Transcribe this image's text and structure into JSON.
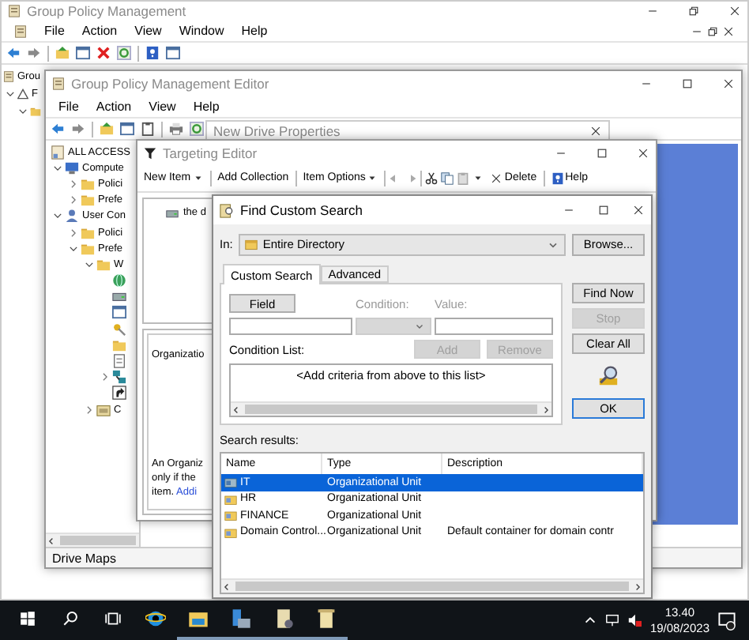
{
  "gpm": {
    "title": "Group Policy Management",
    "menu": [
      "File",
      "Action",
      "View",
      "Window",
      "Help"
    ],
    "tree": [
      {
        "label": "Grou",
        "kind": "console-root",
        "children": [
          {
            "label": "F",
            "kind": "domain",
            "expanded": true,
            "children": [
              {
                "kind": "folder",
                "expanded": true
              }
            ]
          }
        ]
      }
    ]
  },
  "gpme": {
    "title": "Group Policy Management Editor",
    "menu": [
      "File",
      "Action",
      "View",
      "Help"
    ],
    "tree": [
      {
        "label": "ALL ACCESS",
        "kind": "policy",
        "children": [
          {
            "label": "Compute",
            "kind": "computer",
            "expanded": true,
            "children": [
              {
                "label": "Polici",
                "kind": "folder",
                "expanded": false
              },
              {
                "label": "Prefe",
                "kind": "folder",
                "expanded": false
              }
            ]
          },
          {
            "label": "User Con",
            "kind": "user",
            "expanded": true,
            "children": [
              {
                "label": "Polici",
                "kind": "folder",
                "expanded": false
              },
              {
                "label": "Prefe",
                "kind": "folder",
                "expanded": true,
                "children": [
                  {
                    "label": "W",
                    "kind": "folder",
                    "expanded": true,
                    "children": [
                      {
                        "kind": "globe"
                      },
                      {
                        "kind": "drive"
                      },
                      {
                        "kind": "window"
                      },
                      {
                        "kind": "key"
                      },
                      {
                        "kind": "folder"
                      },
                      {
                        "kind": "file"
                      },
                      {
                        "kind": "network",
                        "expanded": false
                      },
                      {
                        "kind": "shortcut"
                      }
                    ]
                  },
                  {
                    "label": "C",
                    "kind": "panel",
                    "expanded": false
                  }
                ]
              }
            ]
          }
        ]
      }
    ],
    "status": "Drive Maps"
  },
  "drive_properties": {
    "title": "New Drive Properties"
  },
  "targeting_editor": {
    "title": "Targeting Editor",
    "toolbar": [
      {
        "kind": "menu",
        "label": "New Item"
      },
      {
        "kind": "button",
        "label": "Add Collection"
      },
      {
        "kind": "menu",
        "label": "Item Options"
      },
      {
        "kind": "delete",
        "label": "Delete"
      },
      {
        "kind": "help",
        "label": "Help"
      }
    ],
    "items": [
      {
        "label": "the d"
      }
    ],
    "description_title": "Organizatio",
    "description_lines": [
      "An Organiz",
      "only if the",
      "item."
    ],
    "description_link": "Addi"
  },
  "find_dialog": {
    "title": "Find Custom Search",
    "in_label": "In:",
    "scope": "Entire Directory",
    "browse": "Browse...",
    "tabs": [
      {
        "label": "Custom Search",
        "selected": true
      },
      {
        "label": "Advanced",
        "selected": false
      }
    ],
    "field_button": "Field",
    "condition_label": "Condition:",
    "value_label": "Value:",
    "condition_list_label": "Condition List:",
    "list_buttons": [
      {
        "label": "Add",
        "disabled": true
      },
      {
        "label": "Remove",
        "disabled": true
      }
    ],
    "empty_list_text": "<Add criteria from above to this list>",
    "actions": [
      {
        "label": "Find Now",
        "disabled": false,
        "default": false
      },
      {
        "label": "Stop",
        "disabled": true,
        "default": false
      },
      {
        "label": "Clear All",
        "disabled": false,
        "default": false
      },
      {
        "kind": "icon"
      },
      {
        "label": "OK",
        "disabled": false,
        "default": true
      }
    ],
    "results_label": "Search results:",
    "columns": [
      "Name",
      "Type",
      "Description"
    ],
    "rows": [
      {
        "name": "IT",
        "type": "Organizational Unit",
        "selected": true
      },
      {
        "name": "HR",
        "type": "Organizational Unit",
        "selected": false
      },
      {
        "name": "FINANCE",
        "type": "Organizational Unit",
        "selected": false
      },
      {
        "name": "Domain Control...",
        "type": "Organizational Unit",
        "description": "Default container for domain contr",
        "selected": false
      }
    ]
  },
  "taskbar": {
    "apps": [
      {
        "kind": "browser",
        "open": false
      },
      {
        "kind": "files",
        "open": true
      },
      {
        "kind": "server",
        "open": true
      },
      {
        "kind": "scroll-tool",
        "open": true
      },
      {
        "kind": "scroll",
        "open": true
      }
    ],
    "time": "13.40",
    "date": "19/08/2023"
  }
}
